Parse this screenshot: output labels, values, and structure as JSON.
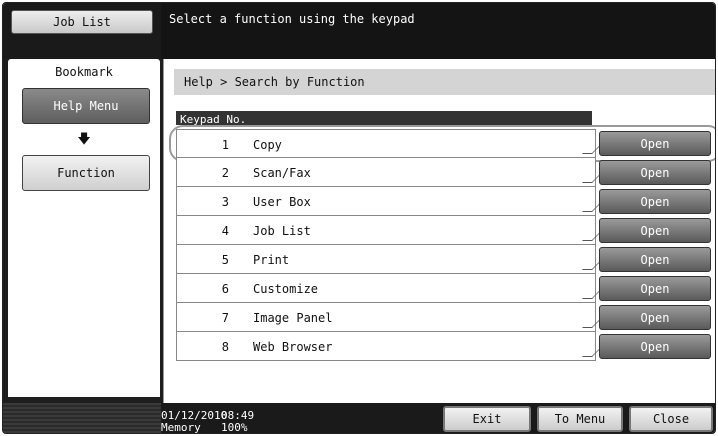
{
  "header": {
    "job_list_label": "Job List",
    "message": "Select a function using the keypad"
  },
  "sidebar": {
    "tab_label": "Bookmark",
    "help_menu_label": "Help Menu",
    "arrow_icon": "arrow-down-icon",
    "function_label": "Function"
  },
  "main": {
    "breadcrumb": "Help > Search by Function",
    "list_header": "Keypad No.",
    "open_label": "Open",
    "items": [
      {
        "num": "1",
        "name": "Copy"
      },
      {
        "num": "2",
        "name": "Scan/Fax"
      },
      {
        "num": "3",
        "name": "User Box"
      },
      {
        "num": "4",
        "name": "Job List"
      },
      {
        "num": "5",
        "name": "Print"
      },
      {
        "num": "6",
        "name": "Customize"
      },
      {
        "num": "7",
        "name": "Image Panel"
      },
      {
        "num": "8",
        "name": "Web Browser"
      }
    ]
  },
  "footer": {
    "date": "01/12/2010",
    "time": "08:49",
    "memory_label": "Memory",
    "memory_value": "100%",
    "exit_label": "Exit",
    "to_menu_label": "To Menu",
    "close_label": "Close"
  }
}
